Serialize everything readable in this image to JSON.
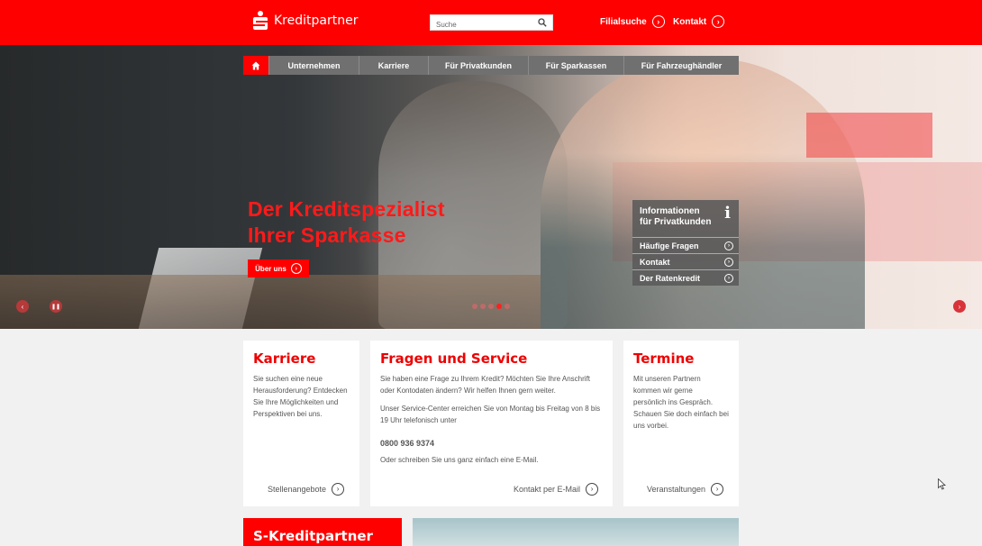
{
  "header": {
    "brand_name": "Kreditpartner",
    "search_placeholder": "Suche",
    "links": [
      {
        "label": "Filialsuche"
      },
      {
        "label": "Kontakt"
      }
    ]
  },
  "nav": {
    "items": [
      "Unternehmen",
      "Karriere",
      "Für Privatkunden",
      "Für Sparkassen",
      "Für Fahrzeughändler"
    ]
  },
  "hero": {
    "headline_line1": "Der Kreditspezialist",
    "headline_line2": "Ihrer Sparkasse",
    "button_label": "Über uns",
    "slide_count": 5,
    "active_slide": 4
  },
  "info_box": {
    "title_line1": "Informationen",
    "title_line2": "für Privatkunden",
    "info_glyph": "i",
    "items": [
      "Häufige Fragen",
      "Kontakt",
      "Der Ratenkredit"
    ]
  },
  "cards": {
    "karriere": {
      "title": "Karriere",
      "text_lines": [
        "Sie suchen eine neue",
        "Herausforderung? Entdecken",
        "Sie Ihre Möglichkeiten und",
        "Perspektiven bei uns."
      ],
      "cta": "Stellenangebote"
    },
    "service": {
      "title": "Fragen und Service",
      "p1_lines": [
        "Sie haben eine Frage zu Ihrem Kredit? Möchten Sie Ihre Anschrift",
        "oder Kontodaten ändern? Wir helfen Ihnen gern weiter."
      ],
      "p2_lines": [
        "Unser Service-Center erreichen Sie von Montag bis Freitag von 8 bis",
        "19 Uhr telefonisch unter"
      ],
      "phone": "0800 936 9374",
      "p3": "Oder schreiben Sie uns ganz einfach eine E-Mail.",
      "cta": "Kontakt per E-Mail"
    },
    "termine": {
      "title": "Termine",
      "text_lines": [
        "Mit unseren Partnern",
        "kommen wir gerne",
        "persönlich ins Gespräch.",
        "Schauen Sie doch einfach bei",
        "uns vorbei."
      ],
      "cta": "Veranstaltungen"
    }
  },
  "bottom": {
    "title": "S-Kreditpartner"
  },
  "colors": {
    "brand_red": "#ff0000",
    "nav_gray": "#707070",
    "text_gray": "#555555"
  }
}
